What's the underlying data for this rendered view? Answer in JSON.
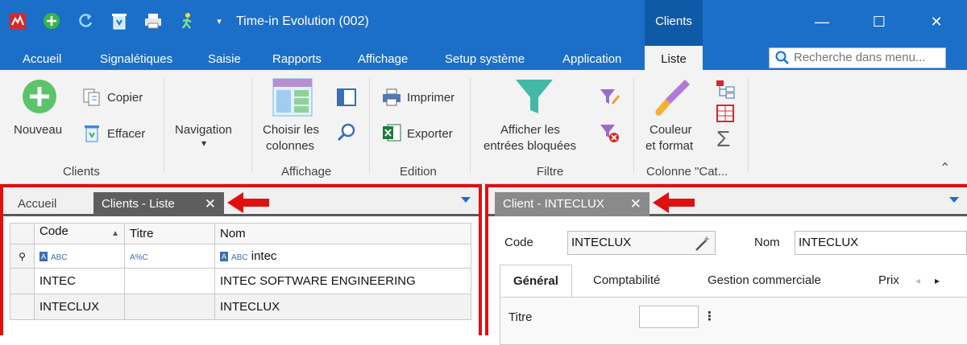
{
  "window": {
    "title": "Time-in Evolution (002)",
    "context_group": "Clients",
    "minimize": "—",
    "maximize": "☐",
    "close": "✕"
  },
  "ribbon_tabs": [
    "Accueil",
    "Signalétiques",
    "Saisie",
    "Rapports",
    "Affichage",
    "Setup système",
    "Application",
    "Liste"
  ],
  "active_ribbon_tab": "Liste",
  "search": {
    "placeholder": "Recherche dans menu..."
  },
  "ribbon": {
    "clients": {
      "nouveau": "Nouveau",
      "copier": "Copier",
      "effacer": "Effacer",
      "group": "Clients"
    },
    "navigation": {
      "label": "Navigation",
      "arrow": "▾"
    },
    "affichage": {
      "choisir_line1": "Choisir les",
      "choisir_line2": "colonnes",
      "group": "Affichage"
    },
    "edition": {
      "imprimer": "Imprimer",
      "exporter": "Exporter",
      "group": "Edition"
    },
    "filtre": {
      "line1": "Afficher les",
      "line2": "entrées bloquées",
      "group": "Filtre"
    },
    "colonne": {
      "line1": "Couleur",
      "line2": "et format",
      "group": "Colonne \"Cat...",
      "sigma": "Σ"
    },
    "collapse": "⌃"
  },
  "left_panel": {
    "tabs": [
      {
        "label": "Accueil"
      },
      {
        "label": "Clients - Liste",
        "close": "✕"
      }
    ],
    "columns": [
      "Code",
      "Titre",
      "Nom"
    ],
    "sort_indicator": "▲",
    "filter_row": {
      "pin": "⚲",
      "code_icon": "ABC",
      "titre_icon": "A%C",
      "nom_icon": "ABC",
      "nom_value": "intec"
    },
    "rows": [
      {
        "code": "INTEC",
        "titre": "",
        "nom": "INTEC SOFTWARE ENGINEERING"
      },
      {
        "code": "INTECLUX",
        "titre": "",
        "nom": "INTECLUX"
      }
    ]
  },
  "right_panel": {
    "tab": {
      "label": "Client - INTECLUX",
      "close": "✕"
    },
    "code_label": "Code",
    "code_value": "INTECLUX",
    "nom_label": "Nom",
    "nom_value": "INTECLUX",
    "subtabs": [
      "Général",
      "Comptabilité",
      "Gestion commerciale",
      "Prix"
    ],
    "subtab_nav": {
      "prev": "◂",
      "next": "▸"
    },
    "titre_label": "Titre",
    "more": "⋮"
  },
  "colors": {
    "titlebar": "#1b6fc8",
    "context_group": "#0f5aa6",
    "highlight_border": "#e01010",
    "active_doc_tab": "#5e5e5e"
  }
}
